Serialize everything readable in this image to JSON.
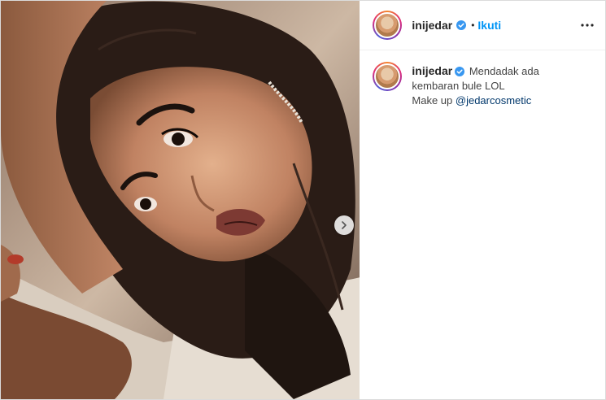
{
  "post": {
    "username": "inijedar",
    "verified": true,
    "separator": "•",
    "follow_label": "Ikuti",
    "more_icon": "more-horizontal-icon",
    "caption": {
      "username": "inijedar",
      "text_line1": "Mendadak ada kembaran bule LOL",
      "make_up_prefix": "Make up ",
      "mention": "@jedarcosmetic"
    },
    "media": {
      "next_icon": "chevron-right-icon"
    }
  },
  "colors": {
    "accent": "#0095f6",
    "mention": "#00376b",
    "verified_badge": "#3897f0"
  }
}
